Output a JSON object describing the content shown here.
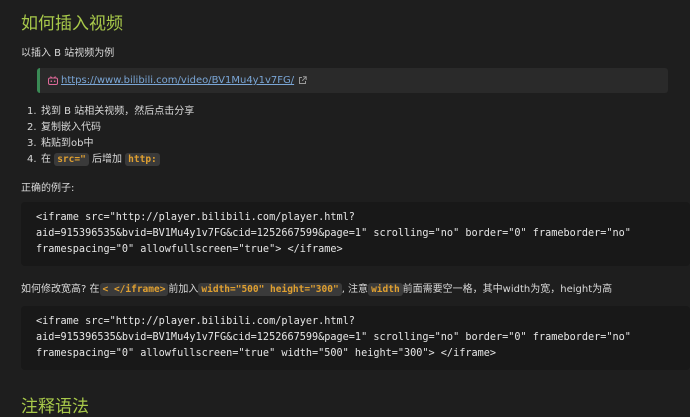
{
  "heading": "如何插入视频",
  "intro": "以插入 B 站视频为例",
  "callout": {
    "icon": "bilibili-icon",
    "link_text": "https://www.bilibili.com/video/BV1Mu4y1v7FG/",
    "external_icon": "external-link-icon"
  },
  "steps": [
    {
      "num": "1.",
      "text": "找到 B 站相关视频，然后点击分享"
    },
    {
      "num": "2.",
      "text": "复制嵌入代码"
    },
    {
      "num": "3.",
      "text": "粘贴到ob中"
    },
    {
      "num": "4.",
      "pre": "在 ",
      "code1": "src=\"",
      "mid": " 后增加 ",
      "code2": "http:"
    }
  ],
  "example_label": "正确的例子:",
  "code1": [
    "<iframe src=\"http://player.bilibili.com/player.html?",
    "aid=915396535&bvid=BV1Mu4y1v7FG&cid=1252667599&page=1\" scrolling=\"no\" border=\"0\" frameborder=\"no\"",
    "framespacing=\"0\" allowfullscreen=\"true\"> </iframe>"
  ],
  "modify": {
    "t1": "如何修改宽高? 在",
    "c1": "< </iframe>",
    "t2": "前加入",
    "c2": "width=\"500\" height=\"300\"",
    "t3": ", 注意",
    "c3": "width",
    "t4": "前面需要空一格，其中width为宽，height为高"
  },
  "code2": [
    "<iframe src=\"http://player.bilibili.com/player.html?",
    "aid=915396535&bvid=BV1Mu4y1v7FG&cid=1252667599&page=1\" scrolling=\"no\" border=\"0\" frameborder=\"no\"",
    "framespacing=\"0\" allowfullscreen=\"true\" width=\"500\" height=\"300\"> </iframe>"
  ],
  "next_heading": "注释语法",
  "colors": {
    "heading": "#a8c94a",
    "link": "#7aa6d6",
    "inline_code": "#e0a030",
    "callout_border": "#3a8a55"
  }
}
